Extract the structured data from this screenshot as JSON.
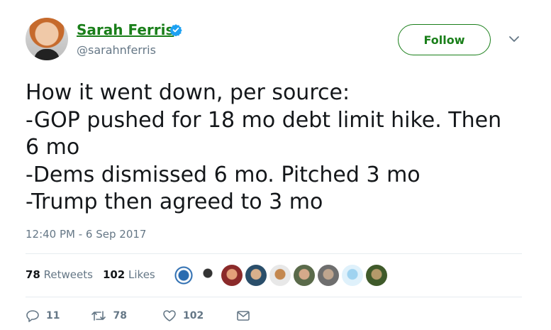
{
  "author": {
    "name": "Sarah Ferris",
    "handle": "@sarahnferris",
    "verified": true
  },
  "follow_button": {
    "label": "Follow"
  },
  "tweet": {
    "lines": [
      "How it went down, per source:",
      "-GOP pushed for 18 mo debt limit hike. Then",
      "6 mo",
      "-Dems dismissed 6 mo. Pitched 3 mo",
      "-Trump then agreed to 3 mo"
    ],
    "timestamp": "12:40 PM - 6 Sep 2017"
  },
  "stats": {
    "retweets_count": "78",
    "retweets_label": "Retweets",
    "likes_count": "102",
    "likes_label": "Likes"
  },
  "actions": {
    "reply_count": "11",
    "retweet_count": "78",
    "like_count": "102"
  },
  "colors": {
    "accent": "#1a7f1a",
    "muted": "#657786",
    "verified": "#1da1f2",
    "divider": "#e6ecf0"
  },
  "icons": [
    "verified-badge-icon",
    "chevron-down-icon",
    "reply-icon",
    "retweet-icon",
    "heart-icon",
    "message-icon"
  ]
}
